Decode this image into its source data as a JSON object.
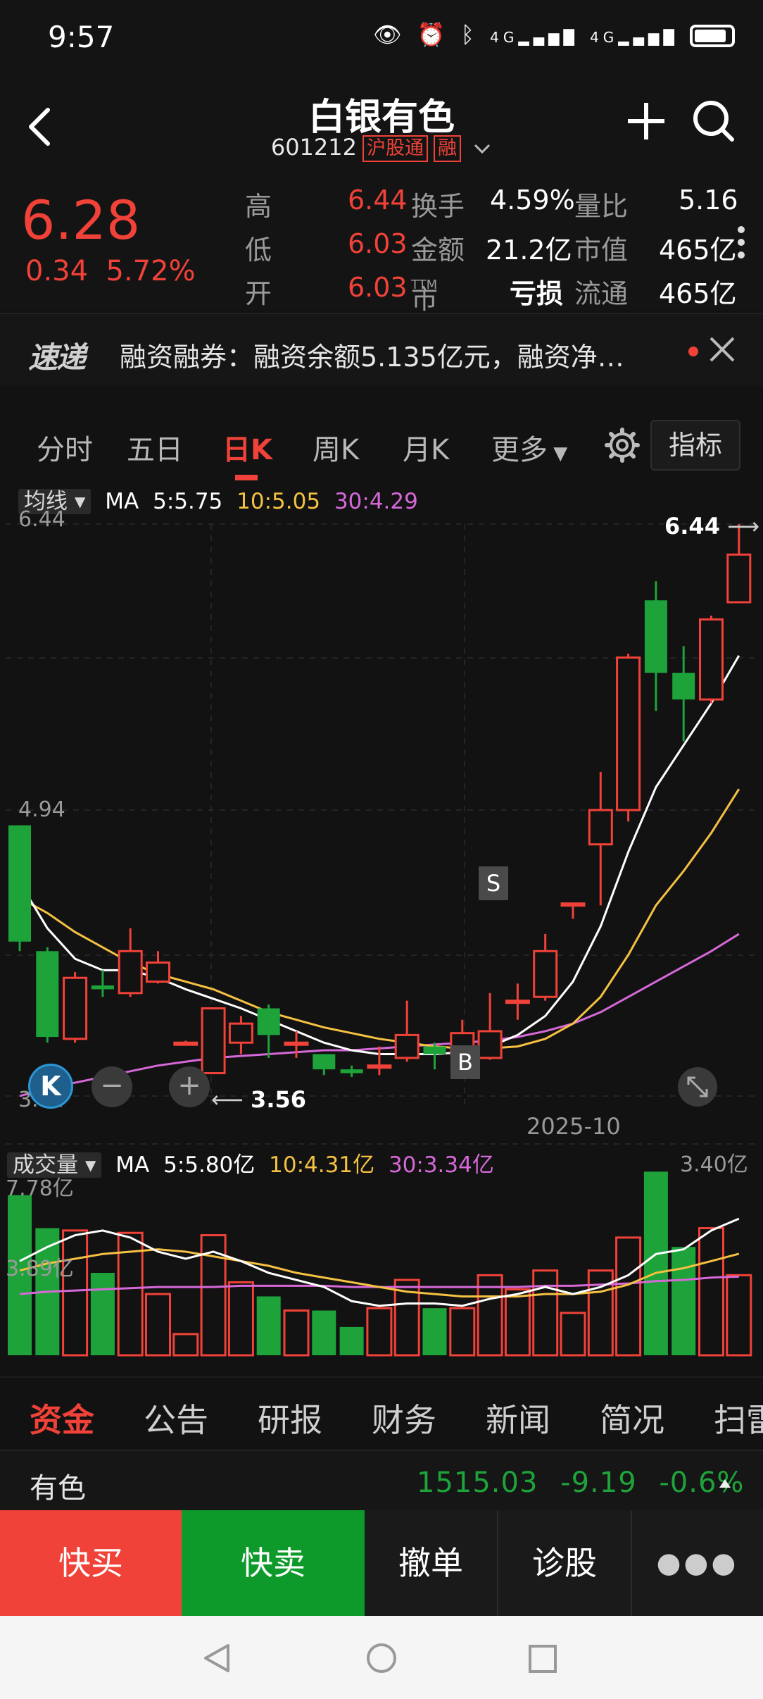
{
  "status_bar": {
    "time": "9:57",
    "icons": [
      "eye-icon",
      "alarm-icon",
      "bluetooth-icon",
      "4g-signal-icon",
      "4g-signal-icon",
      "battery-icon"
    ],
    "net1": "4G",
    "net2": "4G"
  },
  "header": {
    "title": "白银有色",
    "code": "601212",
    "tag1": "沪股通",
    "tag2": "融"
  },
  "quote": {
    "price": "6.28",
    "change": "0.34",
    "change_pct": "5.72%",
    "rows": [
      {
        "l1": "高",
        "v1": "6.44",
        "l2": "换手",
        "v2": "4.59%",
        "l3": "量比",
        "v3": "5.16"
      },
      {
        "l1": "低",
        "v1": "6.03",
        "l2": "金额",
        "v2": "21.2亿",
        "l3": "市值",
        "v3": "465亿"
      },
      {
        "l1": "开",
        "v1": "6.03",
        "l2": "市盈",
        "l2_sub": "TTM",
        "v2": "亏损",
        "l3": "流通",
        "v3": "465亿"
      }
    ]
  },
  "ticker": {
    "logo": "速递",
    "text": "融资融券：融资余额5.135亿元，融资净…"
  },
  "tabs": {
    "items": [
      "分时",
      "五日",
      "日K",
      "周K",
      "月K",
      "更多"
    ],
    "active": "日K",
    "indicator_label": "指标"
  },
  "chart_data": {
    "type": "candlestick",
    "price_axis": {
      "max_label": "6.44",
      "mid_label": "4.94",
      "min_label": "3.44",
      "ylim": [
        3.44,
        6.44
      ]
    },
    "x_label": "2025-10",
    "high_marker": "6.44",
    "low_marker": "3.56",
    "ma_legend": {
      "dropdown": "均线",
      "label": "MA",
      "ma5": "5:5.75",
      "ma10": "10:5.05",
      "ma30": "30:4.29"
    },
    "markers": {
      "sell": "S",
      "buy": "B"
    },
    "colors": {
      "up": "#f04238",
      "down": "#1ea33a",
      "ma5": "#ffffff",
      "ma10": "#f5c142",
      "ma30": "#d668d8"
    },
    "candles": [
      {
        "o": 4.86,
        "c": 4.25,
        "h": 4.86,
        "l": 4.2
      },
      {
        "o": 4.2,
        "c": 3.75,
        "h": 4.22,
        "l": 3.72
      },
      {
        "o": 3.74,
        "c": 4.06,
        "h": 4.09,
        "l": 3.72
      },
      {
        "o": 4.02,
        "c": 4.0,
        "h": 4.1,
        "l": 3.96
      },
      {
        "o": 3.98,
        "c": 4.2,
        "h": 4.32,
        "l": 3.96
      },
      {
        "o": 4.04,
        "c": 4.14,
        "h": 4.2,
        "l": 4.03
      },
      {
        "o": 3.72,
        "c": 3.72,
        "h": 3.73,
        "l": 3.72
      },
      {
        "o": 3.56,
        "c": 3.9,
        "h": 3.9,
        "l": 3.56
      },
      {
        "o": 3.72,
        "c": 3.82,
        "h": 3.86,
        "l": 3.66
      },
      {
        "o": 3.9,
        "c": 3.76,
        "h": 3.92,
        "l": 3.64
      },
      {
        "o": 3.72,
        "c": 3.72,
        "h": 3.78,
        "l": 3.64
      },
      {
        "o": 3.66,
        "c": 3.58,
        "h": 3.66,
        "l": 3.55
      },
      {
        "o": 3.58,
        "c": 3.56,
        "h": 3.6,
        "l": 3.54
      },
      {
        "o": 3.6,
        "c": 3.6,
        "h": 3.7,
        "l": 3.55
      },
      {
        "o": 3.64,
        "c": 3.76,
        "h": 3.94,
        "l": 3.62
      },
      {
        "o": 3.7,
        "c": 3.66,
        "h": 3.72,
        "l": 3.58
      },
      {
        "o": 3.66,
        "c": 3.77,
        "h": 3.84,
        "l": 3.58
      },
      {
        "o": 3.64,
        "c": 3.78,
        "h": 3.98,
        "l": 3.63
      },
      {
        "o": 3.94,
        "c": 3.94,
        "h": 4.03,
        "l": 3.84
      },
      {
        "o": 3.96,
        "c": 4.2,
        "h": 4.29,
        "l": 3.94
      },
      {
        "o": 4.45,
        "c": 4.45,
        "h": 4.45,
        "l": 4.37
      },
      {
        "o": 4.76,
        "c": 4.94,
        "h": 5.14,
        "l": 4.44
      },
      {
        "o": 4.94,
        "c": 5.74,
        "h": 5.76,
        "l": 4.88
      },
      {
        "o": 6.04,
        "c": 5.66,
        "h": 6.14,
        "l": 5.46
      },
      {
        "o": 5.66,
        "c": 5.52,
        "h": 5.8,
        "l": 5.3
      },
      {
        "o": 5.52,
        "c": 5.94,
        "h": 5.96,
        "l": 5.5
      },
      {
        "o": 6.03,
        "c": 6.28,
        "h": 6.44,
        "l": 6.03
      }
    ],
    "ma5": [
      4.56,
      4.32,
      4.16,
      4.1,
      4.1,
      4.06,
      4.0,
      3.95,
      3.9,
      3.84,
      3.78,
      3.72,
      3.68,
      3.66,
      3.66,
      3.66,
      3.67,
      3.7,
      3.76,
      3.86,
      4.04,
      4.33,
      4.72,
      5.06,
      5.28,
      5.5,
      5.75
    ],
    "ma10": [
      4.48,
      4.4,
      4.3,
      4.22,
      4.14,
      4.08,
      4.04,
      4.0,
      3.94,
      3.88,
      3.84,
      3.8,
      3.77,
      3.74,
      3.72,
      3.7,
      3.69,
      3.69,
      3.7,
      3.74,
      3.82,
      3.96,
      4.18,
      4.44,
      4.62,
      4.82,
      5.05
    ],
    "ma30": [
      3.44,
      3.48,
      3.51,
      3.54,
      3.57,
      3.6,
      3.62,
      3.64,
      3.65,
      3.66,
      3.67,
      3.68,
      3.68,
      3.69,
      3.7,
      3.71,
      3.72,
      3.73,
      3.75,
      3.78,
      3.82,
      3.88,
      3.96,
      4.04,
      4.12,
      4.2,
      4.29
    ],
    "volume": {
      "dropdown": "成交量",
      "label": "MA",
      "ma5": "5:5.80亿",
      "ma10": "10:4.31亿",
      "ma30": "30:3.34亿",
      "max_label": "7.78亿",
      "mid_label": "3.89亿",
      "right_label": "3.40亿",
      "ylim": [
        0,
        7.78
      ],
      "values": [
        6.8,
        5.4,
        5.3,
        3.5,
        5.2,
        2.6,
        0.9,
        5.1,
        3.1,
        2.5,
        1.9,
        1.9,
        1.2,
        2.0,
        3.2,
        2.0,
        2.0,
        3.4,
        2.8,
        3.6,
        1.8,
        3.6,
        5.0,
        7.8,
        4.6,
        5.4,
        3.4
      ],
      "ma5_line": [
        4.0,
        4.6,
        5.1,
        5.3,
        5.0,
        4.4,
        4.1,
        4.4,
        4.0,
        3.5,
        3.2,
        2.9,
        2.3,
        2.1,
        2.2,
        2.2,
        2.1,
        2.4,
        2.6,
        2.9,
        2.6,
        2.9,
        3.4,
        4.3,
        4.5,
        5.3,
        5.8
      ],
      "ma10_line": [
        3.6,
        3.9,
        4.1,
        4.3,
        4.4,
        4.5,
        4.4,
        4.2,
        4.0,
        3.8,
        3.5,
        3.3,
        3.1,
        2.9,
        2.7,
        2.6,
        2.5,
        2.5,
        2.5,
        2.6,
        2.6,
        2.7,
        3.0,
        3.5,
        3.7,
        4.0,
        4.31
      ],
      "ma30_line": [
        2.6,
        2.7,
        2.75,
        2.8,
        2.85,
        2.9,
        2.9,
        2.9,
        2.95,
        2.95,
        2.95,
        2.95,
        2.9,
        2.9,
        2.9,
        2.9,
        2.9,
        2.9,
        2.9,
        2.95,
        2.95,
        3.0,
        3.05,
        3.15,
        3.2,
        3.3,
        3.34
      ]
    }
  },
  "bottom_tabs": {
    "items": [
      "资金",
      "公告",
      "研报",
      "财务",
      "新闻",
      "简况",
      "扫雷"
    ],
    "active": "资金"
  },
  "sector": {
    "name": "有色",
    "index": "1515.03",
    "change": "-9.19",
    "change_pct": "-0.6%"
  },
  "actions": {
    "quick_buy": "快买",
    "quick_sell": "快卖",
    "cancel": "撤单",
    "diagnose": "诊股"
  }
}
